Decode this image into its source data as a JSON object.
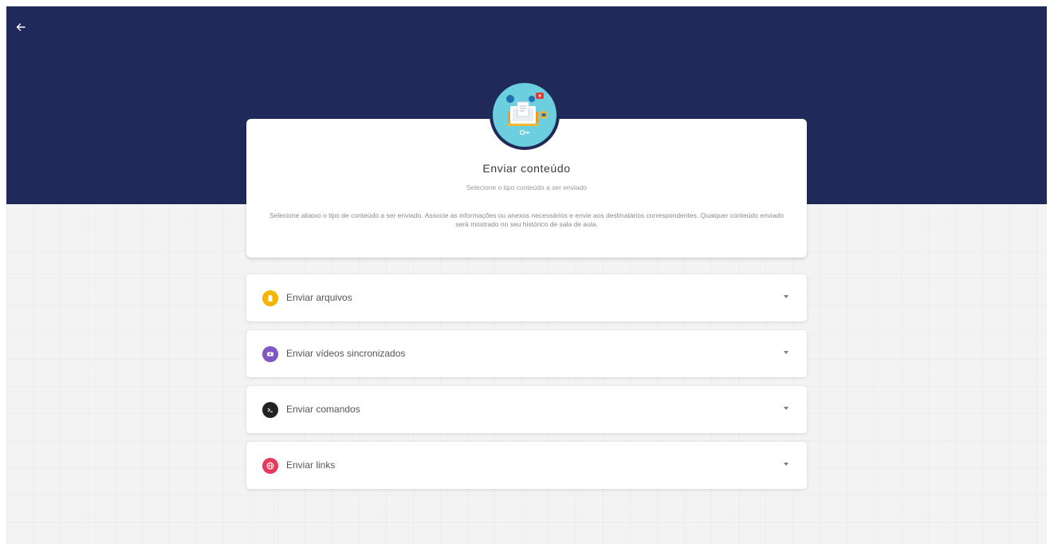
{
  "page": {
    "header_color": "#1f2a5a"
  },
  "card": {
    "title": "Enviar conteúdo",
    "subtitle": "Selecione o tipo conteúdo a ser enviado",
    "description": "Selecione abaixo o tipo de conteúdo a ser enviado. Associe as informações ou anexos necessários e envie aos destinatários correspondentes. Qualquer conteúdo enviado será mostrado no seu histórico de sala de aula.",
    "illustration_icon": "content-sharing-illustration"
  },
  "panels": [
    {
      "label": "Enviar arquivos",
      "icon": "file-icon",
      "color": "#f4b400"
    },
    {
      "label": "Enviar vídeos sincronizados",
      "icon": "video-icon",
      "color": "#7e57c2"
    },
    {
      "label": "Enviar comandos",
      "icon": "terminal-icon",
      "color": "#222222"
    },
    {
      "label": "Enviar links",
      "icon": "globe-icon",
      "color": "#e53a5c"
    }
  ]
}
